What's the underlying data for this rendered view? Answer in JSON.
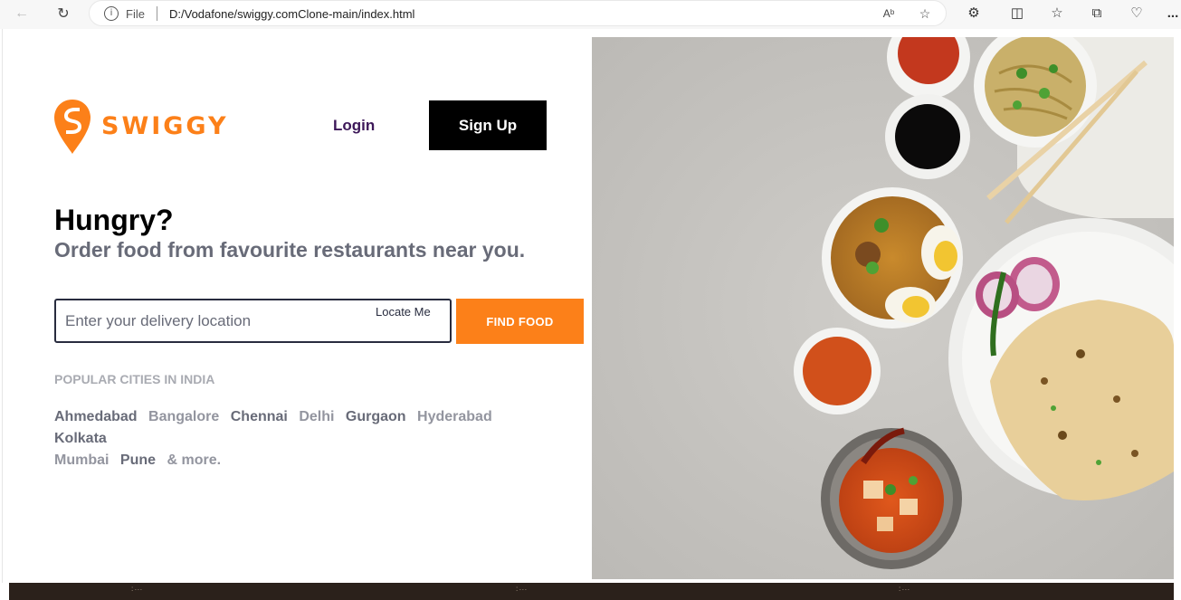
{
  "browser": {
    "file_label": "File",
    "url": "D:/Vodafone/swiggy.comClone-main/index.html",
    "read_aloud_icon": "read-aloud-icon",
    "more_label": "..."
  },
  "header": {
    "brand": "SWIGGY",
    "login_label": "Login",
    "signup_label": "Sign Up"
  },
  "hero_text": {
    "title": "Hungry?",
    "subtitle": "Order food from favourite restaurants near you."
  },
  "search": {
    "placeholder": "Enter your delivery location",
    "locate_label": "Locate Me",
    "find_label": "FIND FOOD"
  },
  "popular": {
    "heading": "POPULAR CITIES IN INDIA",
    "cities": [
      "Ahmedabad",
      "Bangalore",
      "Chennai",
      "Delhi",
      "Gurgaon",
      "Hyderabad",
      "Kolkata",
      "Mumbai",
      "Pune"
    ],
    "more_label": "& more."
  },
  "colors": {
    "brand_orange": "#fc8019",
    "login_purple": "#3d1859"
  }
}
